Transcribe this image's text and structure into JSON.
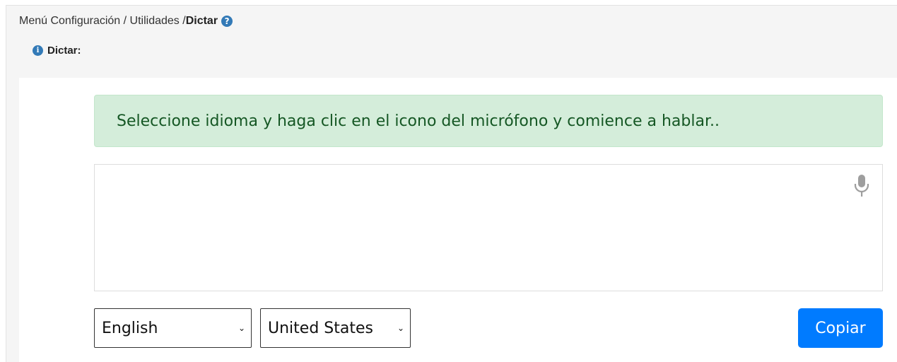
{
  "breadcrumb": {
    "path": "Menú Configuración / Utilidades /",
    "current": "Dictar",
    "help_icon": "?"
  },
  "section": {
    "title": "Dictar:",
    "info_icon": "i"
  },
  "alert": {
    "message": "Seleccione idioma y haga clic en el icono del micrófono y comience a hablar.."
  },
  "dictation": {
    "text": "",
    "mic_icon": "microphone-icon"
  },
  "controls": {
    "language": "English",
    "country": "United States",
    "copy_label": "Copiar"
  },
  "colors": {
    "accent": "#007bff",
    "alert_bg": "#d4edda",
    "alert_text": "#155724",
    "help_icon": "#337ab7"
  }
}
